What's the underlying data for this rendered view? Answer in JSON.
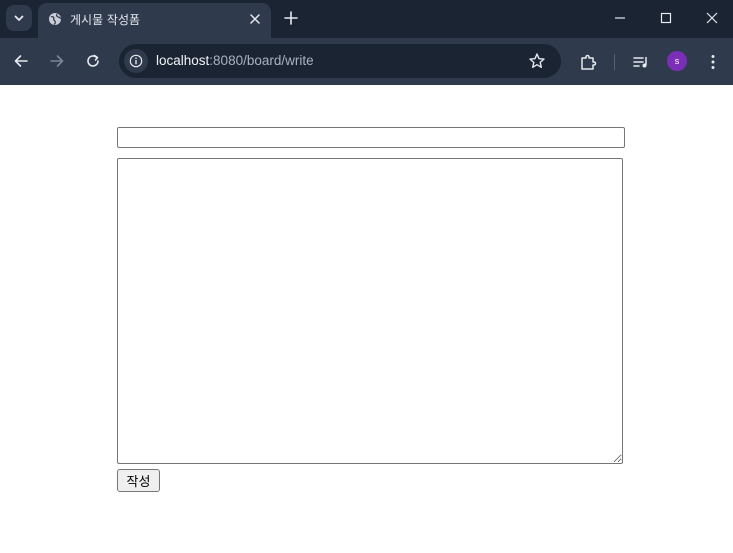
{
  "browser": {
    "tab_title": "게시물 작성폼",
    "url_host": "localhost",
    "url_rest": ":8080/board/write",
    "profile_initial": "s",
    "colors": {
      "titlebar": "#1b2433",
      "toolbar": "#2f3a4d",
      "avatar": "#7b2fb8"
    }
  },
  "icons": {
    "tab_search": "chevron-down-icon",
    "favicon": "globe-icon",
    "tab_close": "close-icon",
    "new_tab": "plus-icon",
    "back": "arrow-left-icon",
    "forward": "arrow-right-icon",
    "reload": "reload-icon",
    "site_info": "info-icon",
    "bookmark": "star-icon",
    "extensions": "puzzle-icon",
    "media": "media-queue-icon",
    "menu": "kebab-menu-icon"
  },
  "form": {
    "title_value": "",
    "body_value": "",
    "submit_label": "작성"
  }
}
